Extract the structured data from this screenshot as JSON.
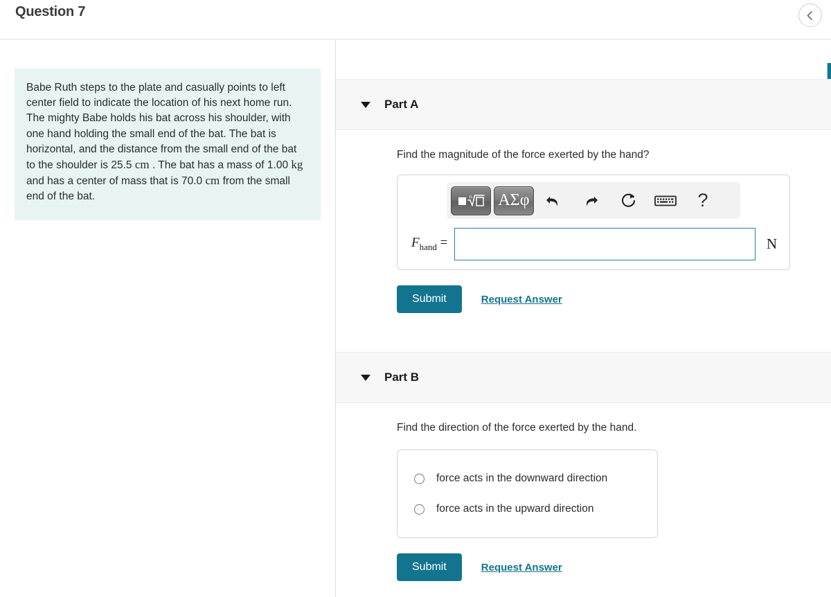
{
  "header": {
    "title": "Question 7",
    "back_icon": "chevron-left-icon",
    "page_number": "7"
  },
  "problem": {
    "text_segments": [
      {
        "t": "Babe Ruth steps to the plate and casually points to left center field to indicate the location of his next home run. The mighty Babe holds his bat across his shoulder, with one hand holding the small end of the bat. The bat is horizontal, and the distance from the small end of the bat to the shoulder is 25.5 ",
        "math": false
      },
      {
        "t": "cm",
        "math": true
      },
      {
        "t": " . The bat has a mass of 1.00 ",
        "math": false
      },
      {
        "t": "kg",
        "math": true
      },
      {
        "t": " and has a center of mass that is 70.0 ",
        "math": false
      },
      {
        "t": "cm",
        "math": true
      },
      {
        "t": " from the small end of the bat.",
        "math": false
      }
    ],
    "background_color": "#e8f4f3"
  },
  "toolbar": {
    "math_template_button": "math-template-icon",
    "greek_button_label": "ΑΣφ",
    "undo_icon": "undo-arrow-icon",
    "redo_icon": "redo-arrow-icon",
    "reset_icon": "reset-circular-arrow-icon",
    "keyboard_icon": "keyboard-icon",
    "help_label": "?"
  },
  "buttons": {
    "submit_label": "Submit",
    "request_answer_label": "Request Answer",
    "accent_color": "#12748f"
  },
  "parts": {
    "a": {
      "label": "Part A",
      "caret": "caret-down-icon",
      "prompt": "Find the magnitude of the force exerted by the hand?",
      "variable": "F",
      "subscript": "hand",
      "equals": " =",
      "input_value": "",
      "input_placeholder": "",
      "unit": "N"
    },
    "b": {
      "label": "Part B",
      "caret": "caret-down-icon",
      "prompt": "Find the direction of the force exerted by the hand.",
      "choices": [
        {
          "label": "force acts in the downward direction",
          "selected": false
        },
        {
          "label": "force acts in the upward direction",
          "selected": false
        }
      ]
    }
  }
}
